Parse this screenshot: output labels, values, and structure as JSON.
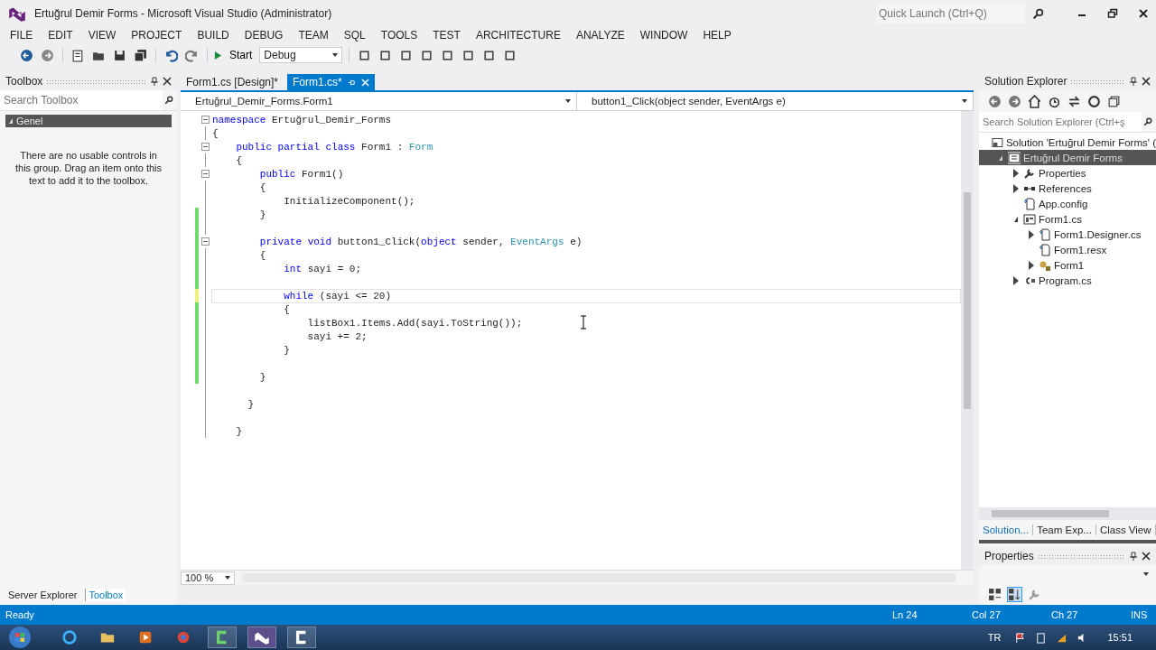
{
  "window": {
    "title": "Ertuğrul Demir Forms - Microsoft Visual Studio (Administrator)",
    "quick_launch": {
      "placeholder": "Quick Launch (Ctrl+Q)"
    }
  },
  "menu": [
    "FILE",
    "EDIT",
    "VIEW",
    "PROJECT",
    "BUILD",
    "DEBUG",
    "TEAM",
    "SQL",
    "TOOLS",
    "TEST",
    "ARCHITECTURE",
    "ANALYZE",
    "WINDOW",
    "HELP"
  ],
  "toolbar": {
    "start": "Start",
    "configuration": "Debug"
  },
  "toolbox": {
    "title": "Toolbox",
    "search": {
      "placeholder": "Search Toolbox"
    },
    "group": {
      "label": "Genel",
      "expanded": true
    },
    "message": "There are no usable controls in this group. Drag an item onto this text to add it to the toolbox.",
    "tabs": [
      {
        "label": "Server Explorer",
        "selected": false
      },
      {
        "label": "Toolbox",
        "selected": true
      }
    ]
  },
  "editor": {
    "tabs": [
      {
        "label": "Form1.cs [Design]*",
        "selected": false
      },
      {
        "label": "Form1.cs*",
        "selected": true
      }
    ],
    "type_dropdown": "Ertuğrul_Demir_Forms.Form1",
    "member_dropdown": "button1_Click(object sender, EventArgs e)",
    "lines": [
      {
        "fold": true,
        "tokens": [
          {
            "t": "namespace",
            "kind": "keyword"
          },
          {
            "t": " Ertuğrul_Demir_Forms"
          }
        ]
      },
      {
        "fold": false,
        "tokens": [
          {
            "t": "{"
          }
        ]
      },
      {
        "fold": true,
        "tokens": [
          {
            "t": "    public",
            "kind": "keyword"
          },
          {
            "t": " partial",
            "kind": "keyword"
          },
          {
            "t": " class",
            "kind": "keyword"
          },
          {
            "t": " Form1 : "
          },
          {
            "t": "Form",
            "kind": "type"
          }
        ]
      },
      {
        "fold": false,
        "tokens": [
          {
            "t": "    {"
          }
        ]
      },
      {
        "fold": true,
        "tokens": [
          {
            "t": "        public",
            "kind": "keyword"
          },
          {
            "t": " Form1()"
          }
        ]
      },
      {
        "fold": false,
        "tokens": [
          {
            "t": "        {"
          }
        ]
      },
      {
        "fold": false,
        "tokens": [
          {
            "t": "            InitializeComponent();"
          }
        ]
      },
      {
        "fold": false,
        "modified": true,
        "saved": true,
        "tokens": [
          {
            "t": "        }"
          }
        ]
      },
      {
        "fold": false,
        "modified": true,
        "saved": true
      },
      {
        "fold": true,
        "modified": true,
        "saved": true,
        "tokens": [
          {
            "t": "        private",
            "kind": "keyword"
          },
          {
            "t": " void",
            "kind": "keyword"
          },
          {
            "t": " button1_Click("
          },
          {
            "t": "object",
            "kind": "keyword"
          },
          {
            "t": " sender, "
          },
          {
            "t": "EventArgs",
            "kind": "type"
          },
          {
            "t": " e)"
          }
        ]
      },
      {
        "fold": false,
        "modified": true,
        "saved": true,
        "tokens": [
          {
            "t": "        {"
          }
        ]
      },
      {
        "fold": false,
        "modified": true,
        "saved": true,
        "tokens": [
          {
            "t": "            int",
            "kind": "keyword"
          },
          {
            "t": " sayi = 0;"
          }
        ]
      },
      {
        "fold": false,
        "modified": true,
        "saved": true
      },
      {
        "fold": false,
        "modified": true,
        "saved": false,
        "current": true,
        "tokens": [
          {
            "t": "            while",
            "kind": "keyword"
          },
          {
            "t": " (sayi <= 20)"
          }
        ]
      },
      {
        "fold": false,
        "modified": true,
        "saved": true,
        "tokens": [
          {
            "t": "            {"
          }
        ]
      },
      {
        "fold": false,
        "modified": true,
        "saved": true,
        "tokens": [
          {
            "t": "                listBox1.Items.Add(sayi.ToString());"
          }
        ]
      },
      {
        "fold": false,
        "modified": true,
        "saved": true,
        "tokens": [
          {
            "t": "                sayi += 2;"
          }
        ]
      },
      {
        "fold": false,
        "modified": true,
        "saved": true,
        "tokens": [
          {
            "t": "            }"
          }
        ]
      },
      {
        "fold": false,
        "modified": true,
        "saved": true
      },
      {
        "fold": false,
        "modified": true,
        "saved": true,
        "tokens": [
          {
            "t": "        }"
          }
        ]
      },
      {
        "fold": false
      },
      {
        "fold": false,
        "tokens": [
          {
            "t": "      }"
          }
        ]
      },
      {
        "fold": false
      },
      {
        "fold": false,
        "tokens": [
          {
            "t": "    }"
          }
        ]
      }
    ],
    "zoom": "100 %"
  },
  "solution_explorer": {
    "title": "Solution Explorer",
    "search": {
      "placeholder": "Search Solution Explorer (Ctrl+ş"
    },
    "tree": [
      {
        "label": "Solution 'Ertuğrul Demir Forms' (",
        "kind": "solution",
        "selected": false,
        "children": [
          {
            "label": "Ertuğrul Demir Forms",
            "kind": "project",
            "selected": true,
            "expanded": true,
            "children": [
              {
                "label": "Properties",
                "kind": "properties",
                "selected": false,
                "expanded": false
              },
              {
                "label": "References",
                "kind": "references",
                "selected": false,
                "expanded": false
              },
              {
                "label": "App.config",
                "kind": "config",
                "selected": false
              },
              {
                "label": "Form1.cs",
                "kind": "form",
                "selected": false,
                "expanded": true,
                "children": [
                  {
                    "label": "Form1.Designer.cs",
                    "kind": "file",
                    "selected": false,
                    "expanded": false
                  },
                  {
                    "label": "Form1.resx",
                    "kind": "file",
                    "selected": false
                  },
                  {
                    "label": "Form1",
                    "kind": "class",
                    "selected": false,
                    "expanded": false
                  }
                ]
              },
              {
                "label": "Program.cs",
                "kind": "csfile",
                "selected": false,
                "expanded": false
              }
            ]
          }
        ]
      }
    ],
    "tabs": [
      {
        "label": "Solution...",
        "selected": true
      },
      {
        "label": "Team Exp...",
        "selected": false
      },
      {
        "label": "Class View",
        "selected": false
      }
    ]
  },
  "properties": {
    "title": "Properties"
  },
  "status_bar": {
    "message": "Ready",
    "line": "Ln 24",
    "column": "Col 27",
    "char": "Ch 27",
    "mode": "INS"
  },
  "taskbar": {
    "language": "TR",
    "time": "15:51"
  }
}
